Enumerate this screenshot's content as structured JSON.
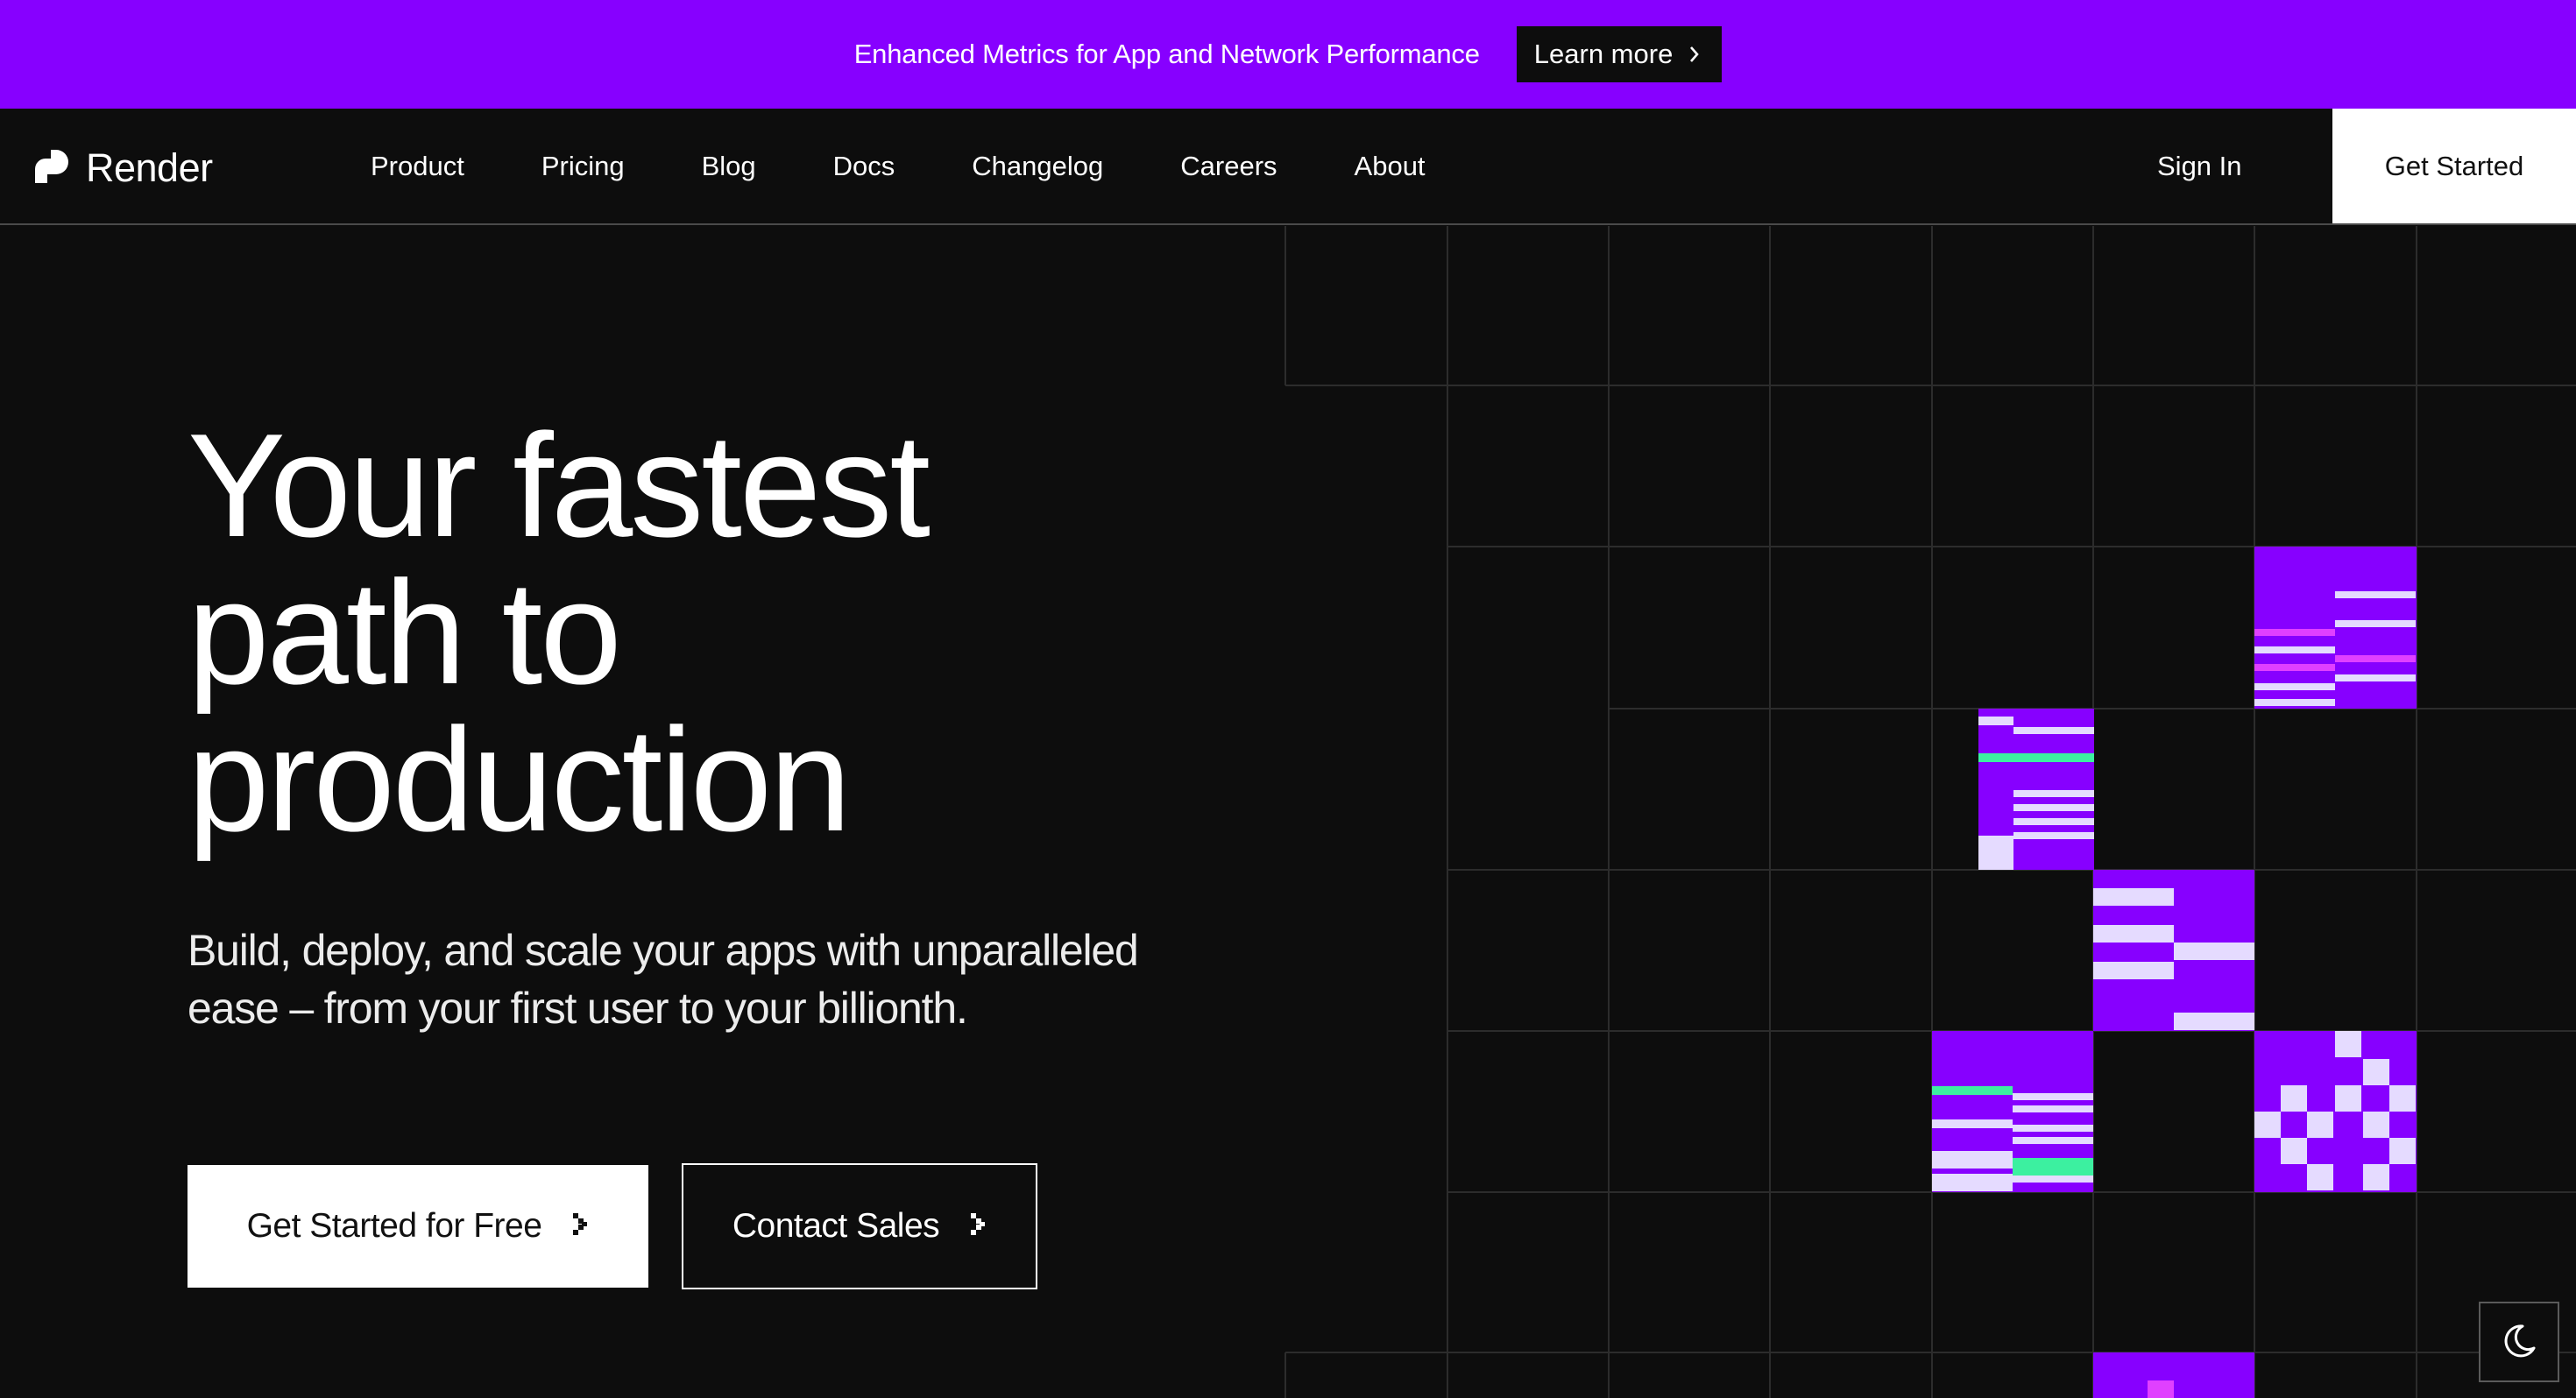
{
  "banner": {
    "text": "Enhanced Metrics for App and Network Performance",
    "button_label": "Learn more"
  },
  "nav": {
    "logo_text": "Render",
    "links": [
      "Product",
      "Pricing",
      "Blog",
      "Docs",
      "Changelog",
      "Careers",
      "About"
    ],
    "sign_in": "Sign In",
    "get_started": "Get Started"
  },
  "hero": {
    "title_lines": [
      "Your fastest",
      "path to",
      "production"
    ],
    "subtitle_lines": [
      "Build, deploy, and scale your apps with unparalleled",
      "ease – from your first user to your billionth."
    ],
    "primary_cta": "Get Started for Free",
    "secondary_cta": "Contact Sales"
  },
  "colors": {
    "brand_purple": "#8700ff",
    "background": "#0d0d0d",
    "accent_pink": "#e040ff",
    "accent_green": "#3cf0a0",
    "tile_light": "#e5dbff"
  },
  "icons": {
    "logo": "render-logo-icon",
    "chevron": "chevron-right-icon",
    "theme": "moon-icon"
  }
}
